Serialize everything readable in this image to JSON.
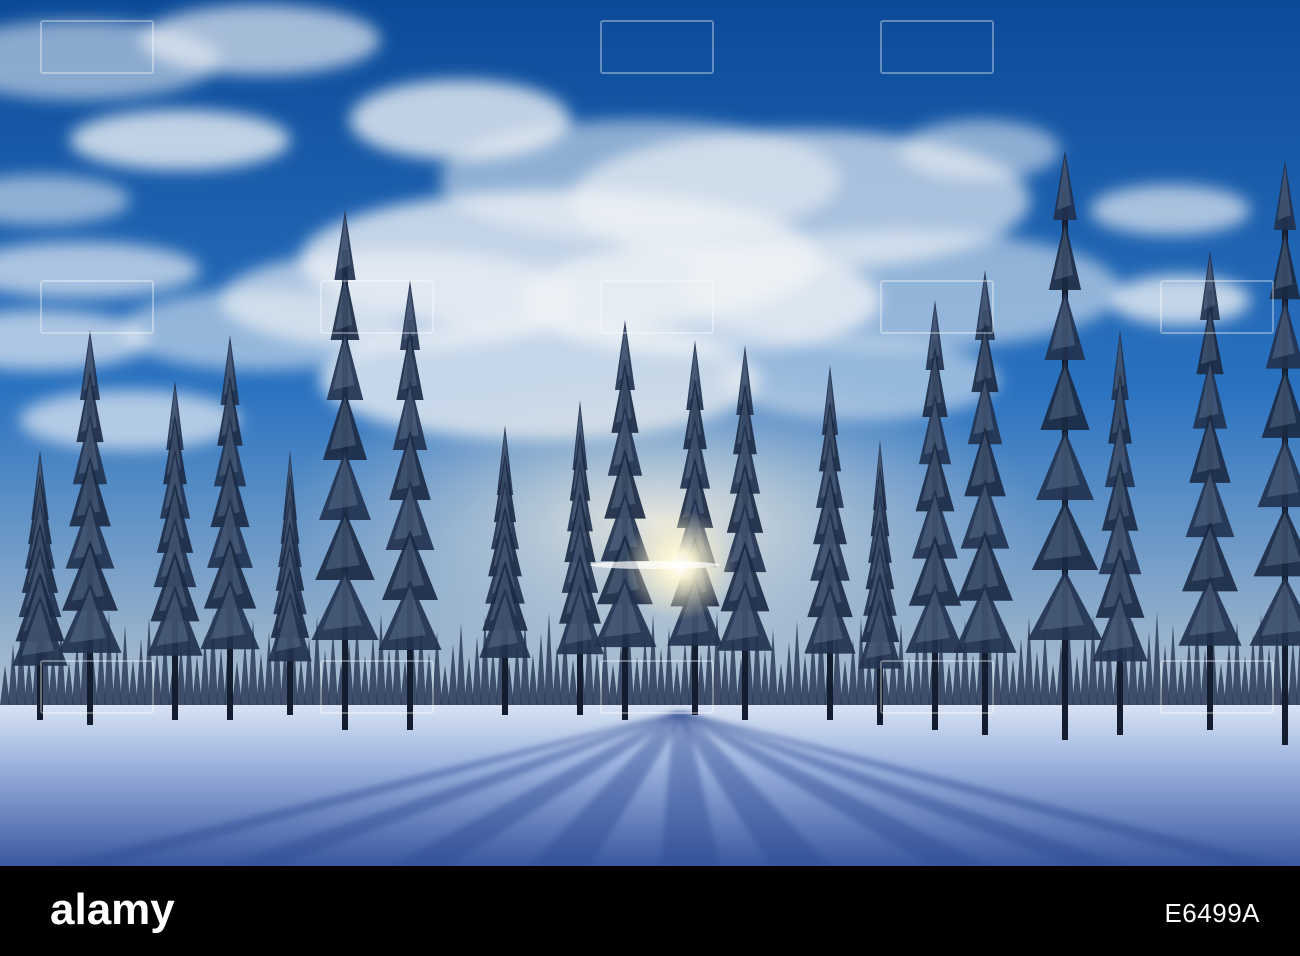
{
  "photo": {
    "subject": "photo",
    "colors": {
      "sky_top": "#0d4f9e",
      "sky_mid": "#2f78c4",
      "cloud": "#eef2f6",
      "horizon_glow": "#cfd8df",
      "tree_dark": "#15223a",
      "tree_frost": "#8fa7c2",
      "snow_light": "#dfe9f7",
      "snow_shadow": "#3e5fa6",
      "sun": "#fffbe8"
    }
  },
  "watermark": {
    "brand": "alamy"
  },
  "footer": {
    "logo_text": "alamy",
    "stock_id": "E6499A"
  }
}
